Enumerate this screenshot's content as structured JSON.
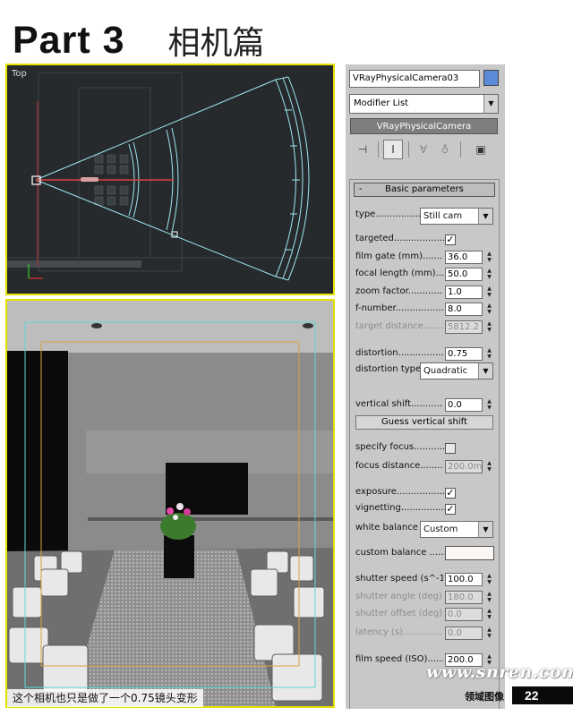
{
  "header": {
    "part": "Part 3",
    "title_cn": "相机篇"
  },
  "viewport_top": {
    "label": "Top"
  },
  "viewport_persp": {
    "caption": "这个相机也只是做了一个0.75镜头变形"
  },
  "panel": {
    "object_name": "VRayPhysicalCamera03",
    "object_color": "#5b8ad6",
    "modifier_list": "Modifier List",
    "stack_item": "VRayPhysicalCamera",
    "toolbar_icons": [
      "pin-stack-icon",
      "show-end-result-icon",
      "make-unique-icon",
      "remove-modifier-icon",
      "configure-modifier-sets-icon"
    ],
    "rollout_title": "Basic parameters",
    "rollout_toggle": "-",
    "params": {
      "type": {
        "label": "type................",
        "value": "Still cam"
      },
      "targeted": {
        "label": "targeted..................",
        "checked": true
      },
      "film_gate": {
        "label": "film gate (mm)..........",
        "value": "36.0"
      },
      "focal_length": {
        "label": "focal length (mm).....",
        "value": "50.0"
      },
      "zoom_factor": {
        "label": "zoom factor..............",
        "value": "1.0"
      },
      "f_number": {
        "label": "f-number..................",
        "value": "8.0"
      },
      "target_distance": {
        "label": "target distance.........",
        "value": "5812.2"
      },
      "distortion": {
        "label": "distortion..................",
        "value": "0.75"
      },
      "distortion_type": {
        "label": "distortion type.",
        "value": "Quadratic"
      },
      "vertical_shift": {
        "label": "vertical shift............",
        "value": "0.0"
      },
      "guess_vertical_shift": "Guess vertical shift",
      "specify_focus": {
        "label": "specify focus...........",
        "checked": false
      },
      "focus_distance": {
        "label": "focus distance.........",
        "value": "200.0m"
      },
      "exposure": {
        "label": "exposure..................",
        "checked": true
      },
      "vignetting": {
        "label": "vignetting..................",
        "checked": true
      },
      "white_balance": {
        "label": "white balance",
        "value": "Custom"
      },
      "custom_balance": {
        "label": "custom balance ......",
        "color": "#fbf7f4"
      },
      "shutter_speed": {
        "label": "shutter speed (s^-1).",
        "value": "100.0"
      },
      "shutter_angle": {
        "label": "shutter angle (deg)..",
        "value": "180.0"
      },
      "shutter_offset": {
        "label": "shutter offset (deg)..",
        "value": "0.0"
      },
      "latency": {
        "label": "latency (s)...............",
        "value": "0.0"
      },
      "film_speed": {
        "label": "film speed (ISO)......",
        "value": "200.0"
      }
    }
  },
  "footer": {
    "watermark": "www.snren.com",
    "section": "领域图像",
    "page": "22"
  }
}
